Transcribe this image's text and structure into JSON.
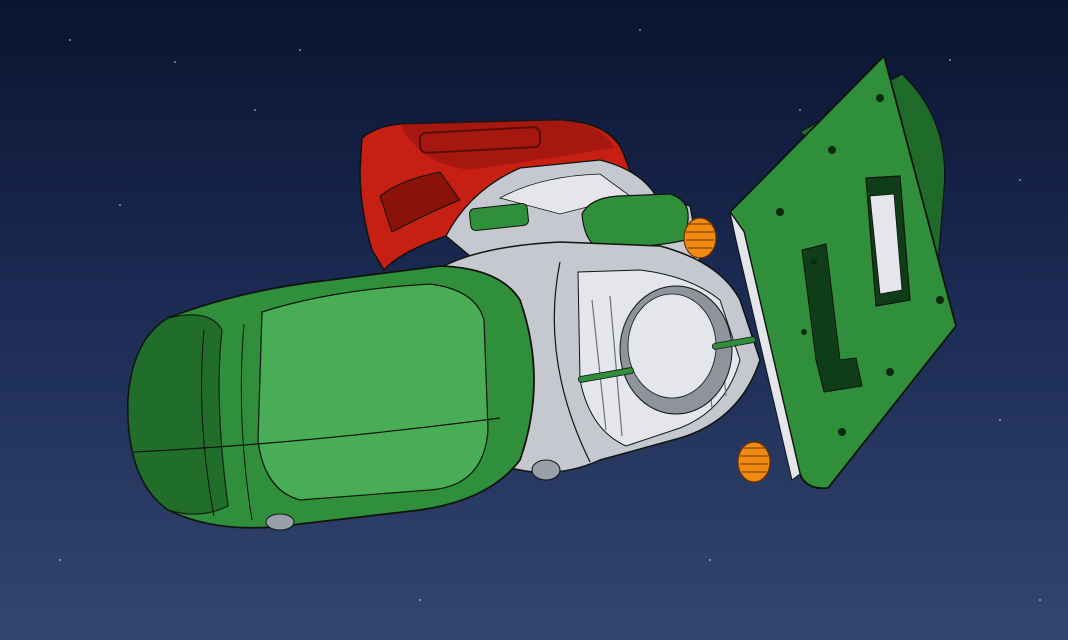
{
  "viewport": {
    "background_top": "#0b1430",
    "background_bottom": "#33466f"
  },
  "model": {
    "label": "",
    "colors": {
      "housing_green": "#2f8f3a",
      "housing_green_dark": "#1f6b29",
      "housing_green_light": "#49ad55",
      "body_gray": "#c5c8cf",
      "body_gray_light": "#e4e6ec",
      "body_gray_dark": "#8e939c",
      "battery_red": "#c81f14",
      "battery_red_dark": "#8a120b",
      "knob_orange": "#f08a10",
      "edge_black": "#101410"
    },
    "parts": [
      {
        "name": "battery-pack",
        "color_key": "battery_red"
      },
      {
        "name": "grip-housing",
        "color_key": "housing_green"
      },
      {
        "name": "motor-housing",
        "color_key": "body_gray"
      },
      {
        "name": "base-plate",
        "color_key": "housing_green"
      },
      {
        "name": "adjust-knob",
        "color_key": "knob_orange"
      }
    ]
  }
}
